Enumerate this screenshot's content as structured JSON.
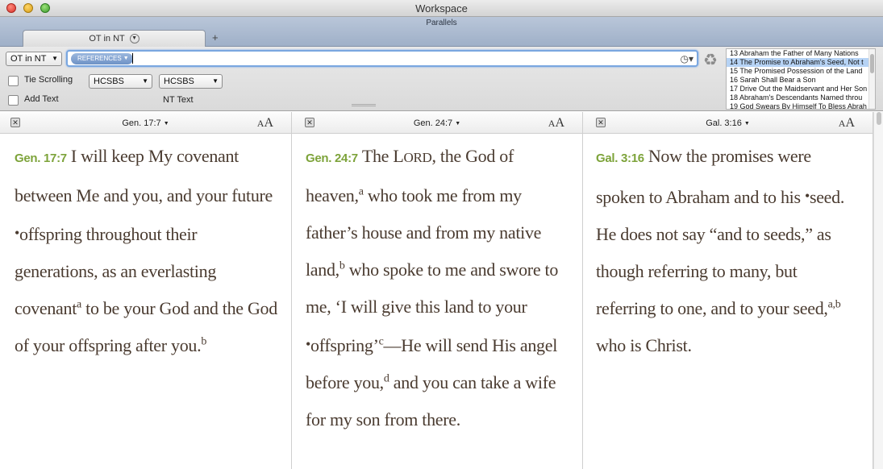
{
  "window": {
    "title": "Workspace",
    "subtitle": "Parallels"
  },
  "tabs": [
    {
      "label": "OT in NT",
      "menu_icon": "chevron-down-icon"
    }
  ],
  "add_tab_label": "+",
  "toolbar": {
    "collection_select": "OT in NT",
    "search_token": "REFERENCES",
    "search_value": "",
    "tie_scrolling_label": "Tie Scrolling",
    "tie_scrolling_checked": false,
    "add_text_label": "Add Text",
    "add_text_checked": false,
    "translation_1": "HCSBS",
    "translation_2": "HCSBS",
    "nt_text_label": "NT Text"
  },
  "headings": [
    {
      "label": "13 Abraham the Father of Many Nations",
      "selected": false
    },
    {
      "label": "14 The Promise to Abraham's Seed, Not t",
      "selected": true
    },
    {
      "label": "15 The Promised Possession of the Land",
      "selected": false
    },
    {
      "label": "16 Sarah Shall Bear a Son",
      "selected": false
    },
    {
      "label": "17 Drive Out the Maidservant and Her Son",
      "selected": false
    },
    {
      "label": "18 Abraham's Descendants Named throu",
      "selected": false
    },
    {
      "label": "19 God Swears By Himself To Bless Abrah",
      "selected": false
    }
  ],
  "panes": [
    {
      "reference": "Gen. 17:7",
      "font_small": "A",
      "font_large": "A",
      "verse_ref": "Gen. 17:7",
      "text_1": "I will keep My covenant between Me and you, and your future ",
      "bullet": "•",
      "text_2": "offspring throughout their generations, as an everlasting covenant",
      "fn_a": "a",
      "text_3": " to be your God and the God of your offspring after you.",
      "fn_b": "b"
    },
    {
      "reference": "Gen. 24:7",
      "font_small": "A",
      "font_large": "A",
      "verse_ref": "Gen. 24:7",
      "text_1": "The L",
      "text_lord_sc": "ORD",
      "text_2": ", the God of heaven,",
      "fn_a": "a",
      "text_3": " who took me from my father’s house and from my native land,",
      "fn_b": "b",
      "text_4": " who spoke to me and swore to me, ‘I will give this land to your ",
      "bullet": "•",
      "text_5": "offspring’",
      "fn_c": "c",
      "text_6": "—He will send His angel before you,",
      "fn_d": "d",
      "text_7": " and you can take a wife for my son from there."
    },
    {
      "reference": "Gal. 3:16",
      "font_small": "A",
      "font_large": "A",
      "verse_ref": "Gal. 3:16",
      "text_1": "Now the promises were spoken to Abraham and to his ",
      "bullet": "•",
      "text_2": "seed. He does not say “and to seeds,” as though referring to many, but referring to one, and to your seed,",
      "fn_ab": "a,b",
      "text_3": " who is Christ."
    }
  ]
}
